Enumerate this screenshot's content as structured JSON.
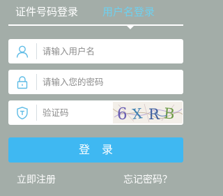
{
  "tabs": {
    "cert_login": "证件号码登录",
    "username_login": "用户名登录",
    "active": "username_login"
  },
  "form": {
    "username": {
      "placeholder": "请输入用户名",
      "value": "",
      "icon": "user-icon"
    },
    "password": {
      "placeholder": "请输入您的密码",
      "value": "",
      "icon": "lock-icon"
    },
    "captcha": {
      "placeholder": "验证码",
      "value": "",
      "icon": "shield-icon",
      "image_text": "6XRB"
    }
  },
  "login_button": "登 录",
  "links": {
    "register": "立即注册",
    "forgot_password": "忘记密码？"
  },
  "colors": {
    "background": "#a3ada8",
    "accent": "#3fb8f2",
    "active_tab": "#6fd0ee",
    "icon": "#5fbce6"
  }
}
